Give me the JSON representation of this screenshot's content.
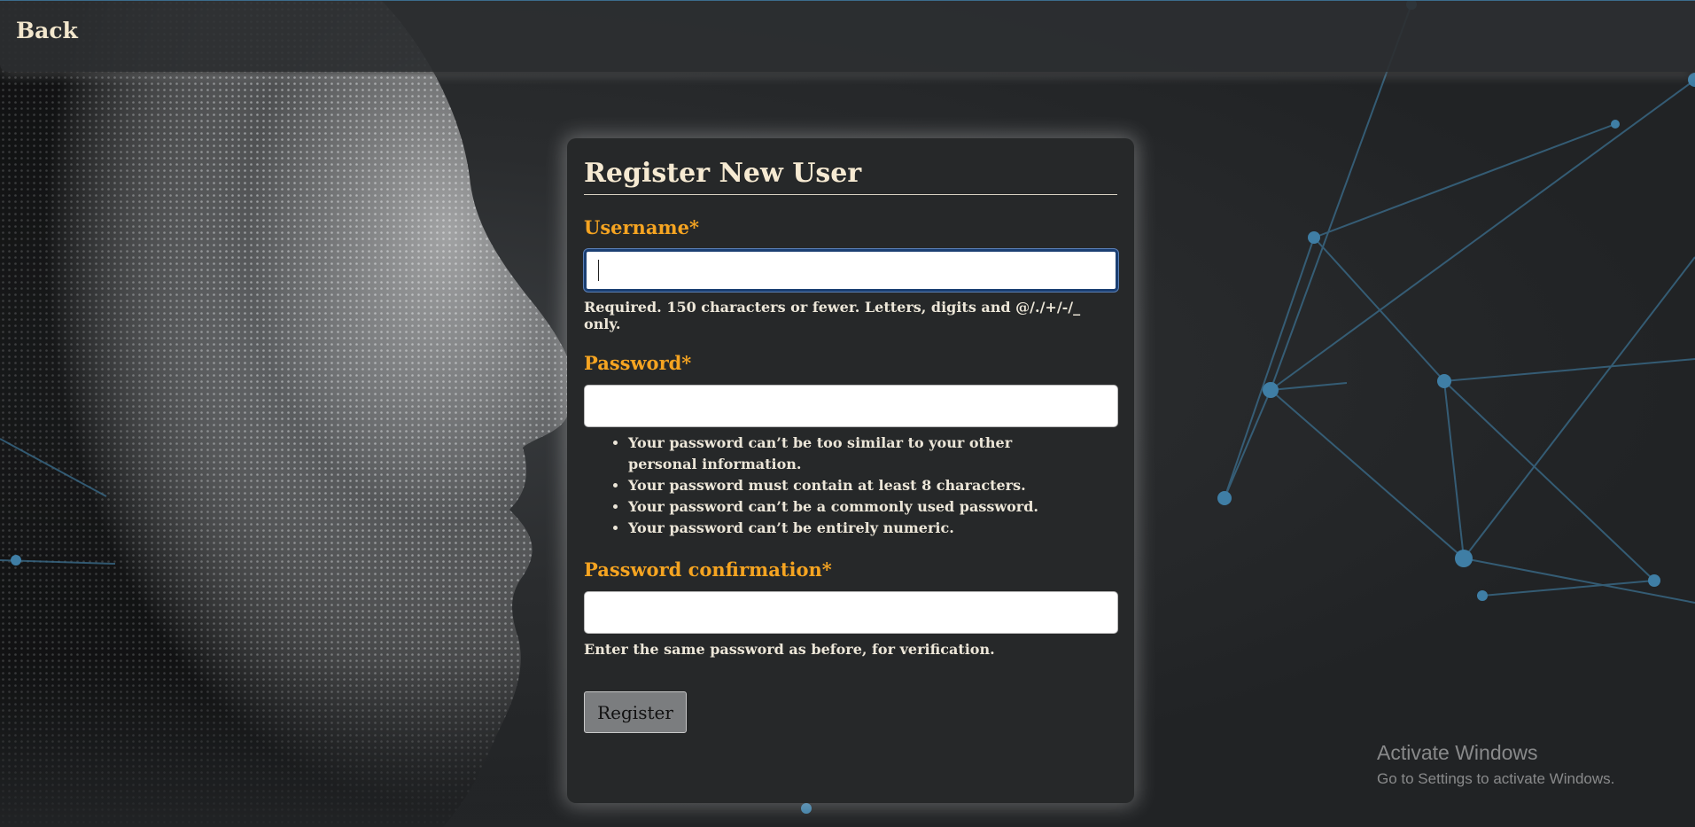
{
  "nav": {
    "back_label": "Back"
  },
  "form": {
    "title": "Register New User",
    "username": {
      "label": "Username*",
      "value": "",
      "help": "Required. 150 characters or fewer. Letters, digits and @/./+/-/_ only."
    },
    "password": {
      "label": "Password*",
      "value": "",
      "rules": [
        "Your password can’t be too similar to your other personal information.",
        "Your password must contain at least 8 characters.",
        "Your password can’t be a commonly used password.",
        "Your password can’t be entirely numeric."
      ]
    },
    "password_confirmation": {
      "label": "Password confirmation*",
      "value": "",
      "help": "Enter the same password as before, for verification."
    },
    "submit_label": "Register"
  },
  "watermark": {
    "title": "Activate Windows",
    "subtitle": "Go to Settings to activate Windows."
  },
  "colors": {
    "label_accent": "#f5a421",
    "title_text": "#f6ead2",
    "background": "#232527",
    "network_lines": "#3b6f8f"
  }
}
